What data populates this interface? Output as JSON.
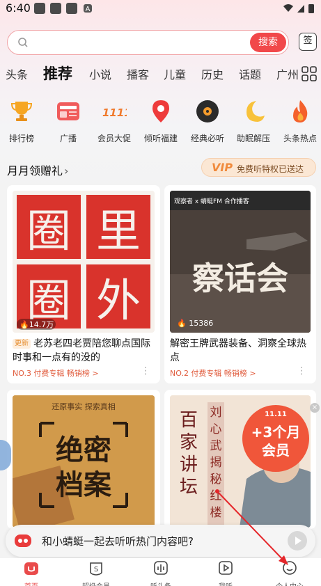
{
  "status": {
    "time": "6:40",
    "notif_letter": "A"
  },
  "search": {
    "placeholder": "",
    "button": "搜索",
    "sign_in": "签"
  },
  "tabs": [
    {
      "label": "头条"
    },
    {
      "label": "推荐"
    },
    {
      "label": "小说"
    },
    {
      "label": "播客"
    },
    {
      "label": "儿童"
    },
    {
      "label": "历史"
    },
    {
      "label": "话题"
    },
    {
      "label": "广州"
    }
  ],
  "categories": [
    {
      "label": "排行榜",
      "icon": "trophy-icon"
    },
    {
      "label": "广播",
      "icon": "radio-icon"
    },
    {
      "label": "会员大促",
      "icon": "vip-promo-icon"
    },
    {
      "label": "倾听福建",
      "icon": "map-pin-icon"
    },
    {
      "label": "经典必听",
      "icon": "record-icon"
    },
    {
      "label": "助眠解压",
      "icon": "moon-icon"
    },
    {
      "label": "头条热点",
      "icon": "flame-icon"
    }
  ],
  "section": {
    "title": "月月领赠礼",
    "vip_badge": "VIP",
    "vip_text": "免费听特权已送达"
  },
  "cards": [
    {
      "plays": "14.7万",
      "tag": "更新",
      "title": "老苏老四老贾陪您聊点国际时事和一点有的没的",
      "rank": "NO.3 付费专辑 畅销榜 >",
      "cover_text": "圈里圈外"
    },
    {
      "plays": "15386",
      "tag": "",
      "title": "解密王牌武器装备、洞察全球热点",
      "rank": "NO.2 付费专辑 畅销榜 >",
      "cover_text": "察话会",
      "cover_brand": "观察者 x 蜻蜓FM 合作播客"
    },
    {
      "cover_text": "绝密档案",
      "cover_sub": "还原事实 探索真相"
    },
    {
      "cover_text": "百家讲坛",
      "cover_sub": "刘心武揭秘红楼梦",
      "promo": "+3个月会员",
      "promo_date": "11.11"
    }
  ],
  "chat": {
    "text": "和小蜻蜓一起去听听热门内容吧?"
  },
  "nav": [
    {
      "label": "首页",
      "icon": "home-icon"
    },
    {
      "label": "超级会员",
      "icon": "vip-icon"
    },
    {
      "label": "听头条",
      "icon": "news-audio-icon"
    },
    {
      "label": "我听",
      "icon": "play-icon"
    },
    {
      "label": "个人中心",
      "icon": "profile-icon"
    }
  ],
  "colors": {
    "accent": "#f1484a",
    "vip": "#f08a3c"
  }
}
